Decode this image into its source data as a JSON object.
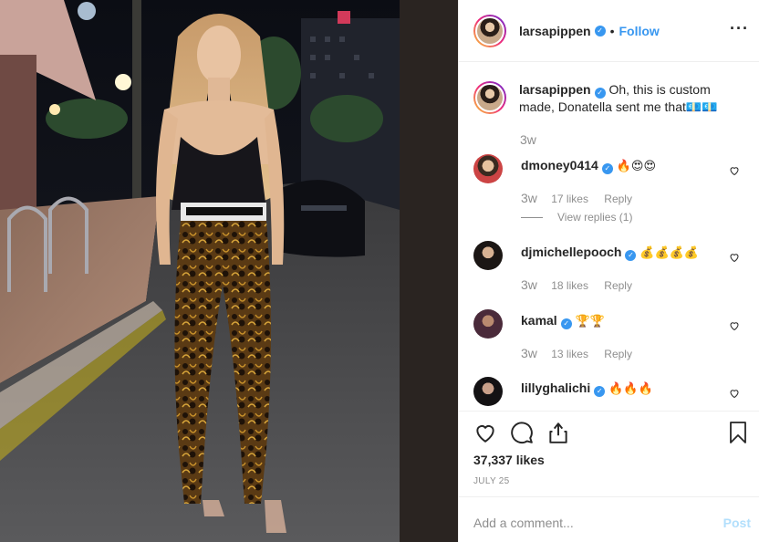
{
  "post": {
    "username": "larsapippen",
    "follow_label": "Follow",
    "more_icon": "more-options-icon"
  },
  "caption": {
    "username": "larsapippen",
    "text": "Oh, this is custom made, Donatella sent me that💶💶",
    "time": "3w"
  },
  "comments": [
    {
      "username": "dmoney0414",
      "text": "🔥😍😍",
      "time": "3w",
      "likes": "17 likes",
      "reply": "Reply",
      "view_replies": "View replies (1)"
    },
    {
      "username": "djmichellepooch",
      "text": "💰💰💰💰",
      "time": "3w",
      "likes": "18 likes",
      "reply": "Reply"
    },
    {
      "username": "kamal",
      "text": "🏆🏆",
      "time": "3w",
      "likes": "13 likes",
      "reply": "Reply"
    },
    {
      "username": "lillyghalichi",
      "text": "🔥🔥🔥"
    }
  ],
  "actions": {
    "likes": "37,337 likes",
    "date": "JULY 25"
  },
  "add_comment": {
    "placeholder": "Add a comment...",
    "post_label": "Post"
  },
  "colors": {
    "accent": "#3897f0",
    "muted": "#8e8e8e",
    "post_disabled": "#b2dffc"
  }
}
